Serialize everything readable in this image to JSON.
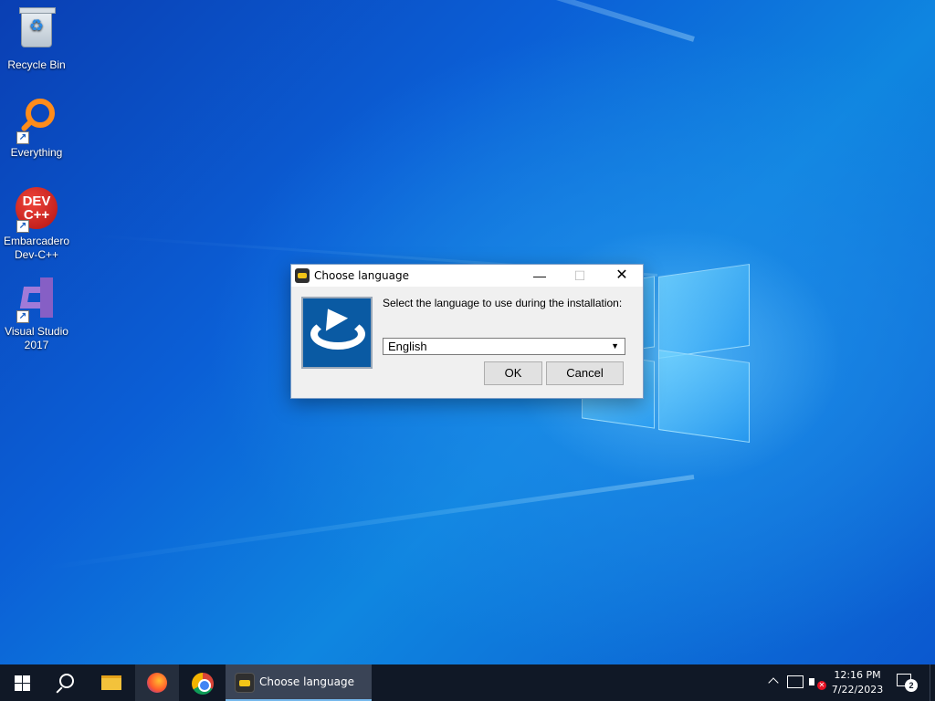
{
  "desktop": {
    "icons": [
      {
        "label": "Recycle Bin",
        "icon": "recycle-bin-icon"
      },
      {
        "label": "Everything",
        "icon": "everything-search-icon"
      },
      {
        "label": "Embarcadero Dev-C++",
        "icon": "devcpp-icon",
        "glyph": "DEV C++"
      },
      {
        "label": "Visual Studio 2017",
        "icon": "visual-studio-icon"
      }
    ]
  },
  "dialog": {
    "title": "Choose language",
    "controls": {
      "minimize": "—",
      "maximize": "☐",
      "close": "✕"
    },
    "prompt": "Select the language to use during the installation:",
    "language": {
      "selected": "English"
    },
    "ok_label": "OK",
    "cancel_label": "Cancel"
  },
  "taskbar": {
    "pinned": [
      "windows-start",
      "search",
      "file-explorer",
      "firefox",
      "chrome"
    ],
    "active_app_label": "Choose language",
    "clock": {
      "time": "12:16 PM",
      "date": "7/22/2023"
    },
    "notification_count": "2"
  }
}
